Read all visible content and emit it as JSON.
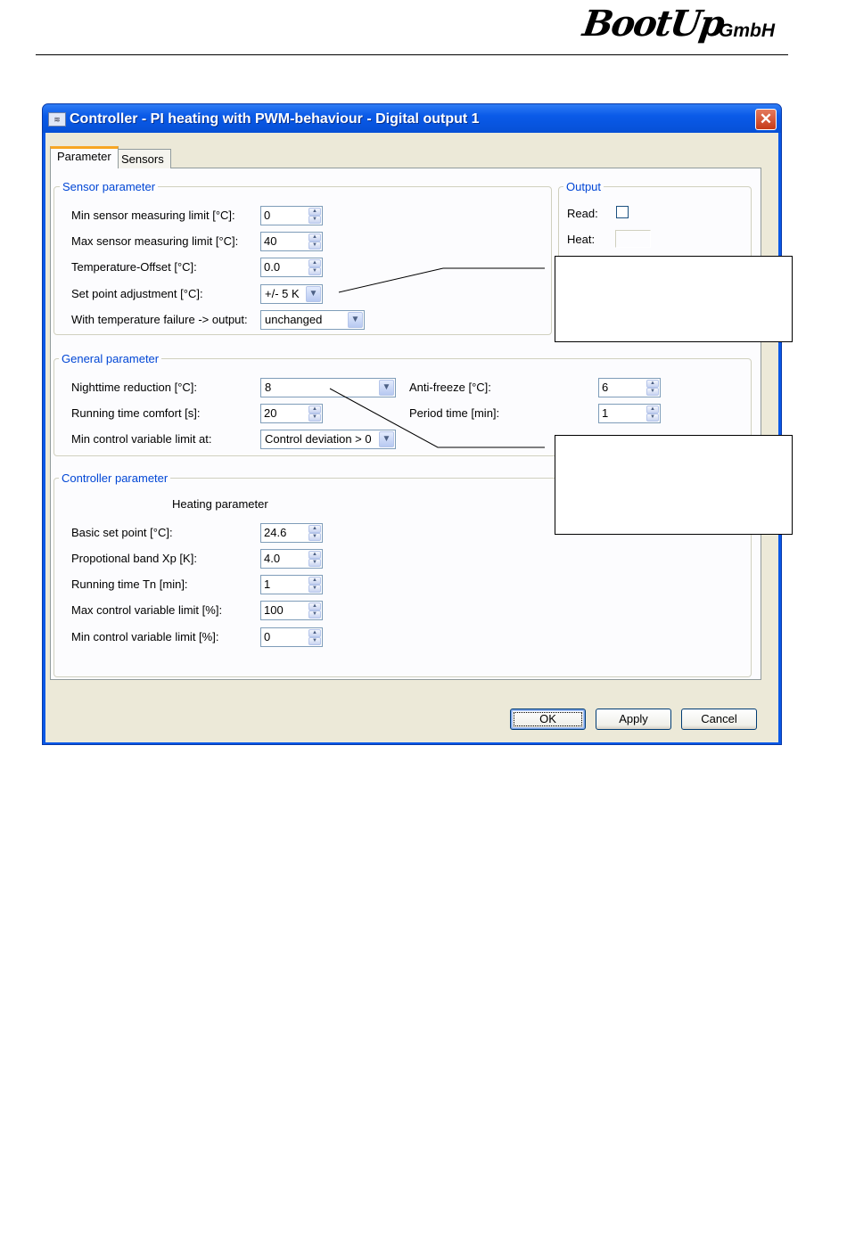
{
  "header": {
    "logo_main": "BootUp",
    "logo_sub": "GmbH"
  },
  "window": {
    "title": "Controller - PI heating with PWM-behaviour - Digital output 1",
    "close_symbol": "✕"
  },
  "tabs": [
    {
      "label": "Parameter",
      "active": true
    },
    {
      "label": "Sensors",
      "active": false
    }
  ],
  "sensor_parameter": {
    "legend": "Sensor parameter",
    "min_limit": {
      "label": "Min sensor measuring limit [°C]:",
      "value": "0"
    },
    "max_limit": {
      "label": "Max sensor measuring limit [°C]:",
      "value": "40"
    },
    "offset": {
      "label": "Temperature-Offset [°C]:",
      "value": "0.0"
    },
    "setpoint_adj": {
      "label": "Set point adjustment [°C]:",
      "value": "+/- 5 K"
    },
    "failure": {
      "label": "With temperature failure -> output:",
      "value": "unchanged"
    }
  },
  "output": {
    "legend": "Output",
    "read_label": "Read:",
    "read_checked": false,
    "heat_label": "Heat:"
  },
  "general_parameter": {
    "legend": "General parameter",
    "night_reduction": {
      "label": "Nighttime reduction [°C]:",
      "value": "8"
    },
    "running_comfort": {
      "label": "Running time comfort [s]:",
      "value": "20"
    },
    "min_limit_at": {
      "label": "Min control variable limit at:",
      "value": "Control deviation > 0"
    },
    "anti_freeze": {
      "label": "Anti-freeze [°C]:",
      "value": "6"
    },
    "period_time": {
      "label": "Period time [min]:",
      "value": "1"
    }
  },
  "controller_parameter": {
    "legend": "Controller parameter",
    "heading": "Heating parameter",
    "basic_setpoint": {
      "label": "Basic set point [°C]:",
      "value": "24.6"
    },
    "prop_band": {
      "label": "Propotional band Xp [K]:",
      "value": "4.0"
    },
    "running_tn": {
      "label": "Running time Tn [min]:",
      "value": "1"
    },
    "max_var": {
      "label": "Max control variable limit [%]:",
      "value": "100"
    },
    "min_var": {
      "label": "Min control variable limit [%]:",
      "value": "0"
    }
  },
  "buttons": {
    "ok": "OK",
    "apply": "Apply",
    "cancel": "Cancel"
  },
  "icons": {
    "spin_up": "up-arrow-icon",
    "spin_down": "down-arrow-icon",
    "dropdown": "chevron-down-icon"
  },
  "colors": {
    "titlebar": "#0a5ae8",
    "legend_text": "#0046d5",
    "dialog_bg": "#ece9d8",
    "active_tab_accent": "#f7a623"
  }
}
